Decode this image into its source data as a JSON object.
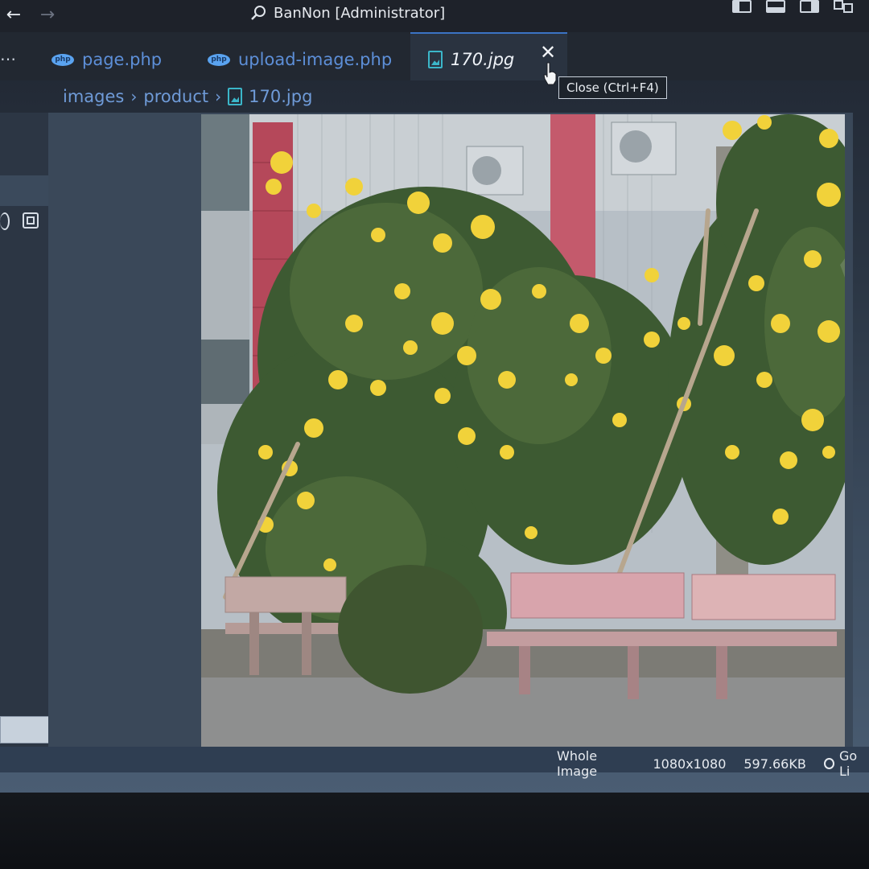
{
  "window": {
    "title": "BanNon [Administrator]"
  },
  "nav": {
    "back_icon": "arrow-left-icon",
    "forward_icon": "arrow-right-icon"
  },
  "tabs": [
    {
      "label": "page.php",
      "icon": "php-icon",
      "active": false
    },
    {
      "label": "upload-image.php",
      "icon": "php-icon",
      "active": false
    },
    {
      "label": "170.jpg",
      "icon": "image-file-icon",
      "active": true
    }
  ],
  "tab_close": {
    "symbol": "✕",
    "tooltip": "Close (Ctrl+F4)"
  },
  "breadcrumb": {
    "items": [
      "images",
      "product",
      "170.jpg"
    ],
    "separator": "›"
  },
  "php_badge": "php",
  "more_symbol": "…",
  "statusbar": {
    "view_mode": "Whole Image",
    "dimensions": "1080x1080",
    "file_size": "597.66KB",
    "live": "Go Li"
  },
  "colors": {
    "accent": "#3b73c4",
    "link": "#5d8fd8",
    "image_icon": "#3bb6c9"
  }
}
